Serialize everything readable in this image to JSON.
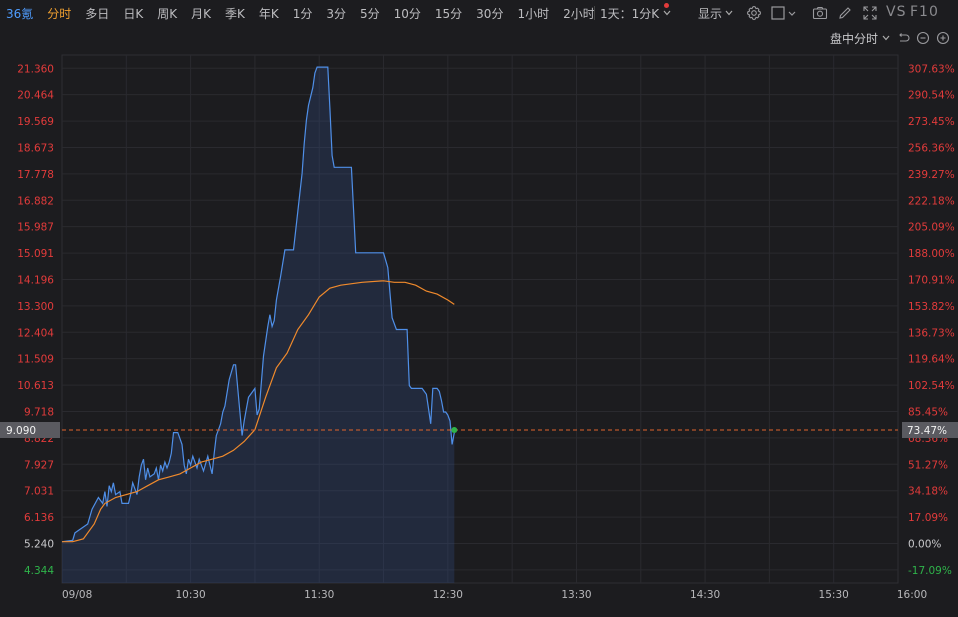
{
  "toolbar": {
    "stock_name": "36氪",
    "tabs": [
      "分时",
      "多日",
      "日K",
      "周K",
      "月K",
      "季K",
      "年K",
      "1分",
      "3分",
      "5分",
      "10分",
      "15分",
      "30分",
      "1小时",
      "2小时"
    ],
    "active_tab": "分时",
    "period_selector": "1天：1分K",
    "display_label": "显示",
    "vs_label": "VS",
    "f10_label": "F10"
  },
  "subbar": {
    "mode_label": "盘中分时"
  },
  "colors": {
    "price_line": "#4f8fe8",
    "avg_line": "#f08a2c",
    "up": "#e23b3b",
    "down": "#2fb34a",
    "ref_line": "#e0642c"
  },
  "current_price_tag": "9.090",
  "current_pct_tag": "73.47%",
  "chart_data": {
    "type": "line",
    "title": "",
    "xlabel": "",
    "ylabel": "",
    "ylim": [
      3.9,
      21.81
    ],
    "prev_close": 5.24,
    "left_axis_ticks": [
      "21.360",
      "20.464",
      "19.569",
      "18.673",
      "17.778",
      "16.882",
      "15.987",
      "15.091",
      "14.196",
      "13.300",
      "12.404",
      "11.509",
      "10.613",
      "9.718",
      "8.822",
      "7.927",
      "7.031",
      "6.136",
      "5.240",
      "4.344"
    ],
    "right_axis_ticks": [
      "307.63%",
      "290.54%",
      "273.45%",
      "256.36%",
      "239.27%",
      "222.18%",
      "205.09%",
      "188.00%",
      "170.91%",
      "153.82%",
      "136.73%",
      "119.64%",
      "102.54%",
      "85.45%",
      "68.36%",
      "51.27%",
      "34.18%",
      "17.09%",
      "0.00%",
      "-17.09%"
    ],
    "x_ticks": [
      "09/08",
      "10:30",
      "11:30",
      "12:30",
      "13:30",
      "14:30",
      "15:30",
      "16:00"
    ],
    "x_tick_minutes": [
      0,
      60,
      120,
      180,
      240,
      300,
      360,
      390
    ],
    "x_range": [
      0,
      390
    ],
    "series": [
      {
        "name": "",
        "kind": "price",
        "x": [
          0,
          5,
          6,
          12,
          14,
          17,
          19,
          20,
          21,
          22,
          23,
          24,
          25,
          27,
          28,
          31,
          32,
          33,
          35,
          36,
          37,
          38,
          39,
          40,
          41,
          43,
          44,
          45,
          46,
          47,
          48,
          49,
          50,
          51,
          52,
          54,
          56,
          57,
          58,
          59,
          60,
          61,
          63,
          64,
          66,
          68,
          70,
          71,
          72,
          73,
          74,
          75,
          76,
          78,
          80,
          81,
          83,
          84,
          85,
          86,
          87,
          89,
          90,
          91,
          92,
          94,
          96,
          97,
          98,
          99,
          100,
          102,
          104,
          105,
          106,
          107,
          108,
          110,
          112,
          113,
          114,
          115,
          117,
          118,
          119,
          120,
          121,
          122,
          123,
          124,
          125,
          126,
          127,
          128,
          129,
          130,
          131,
          132,
          133,
          134,
          135,
          136,
          137,
          138,
          139,
          140,
          141,
          142,
          143,
          144,
          146,
          148,
          150,
          152,
          154,
          156,
          158,
          160,
          161,
          162,
          163,
          164,
          165,
          166,
          167,
          168,
          169,
          170,
          171,
          172,
          173,
          174,
          175,
          176,
          177,
          178,
          179,
          180,
          181,
          182,
          183
        ],
        "values": [
          5.3,
          5.35,
          5.6,
          5.9,
          6.4,
          6.8,
          6.6,
          7.0,
          6.5,
          7.2,
          7.0,
          7.3,
          6.9,
          7.0,
          6.6,
          6.6,
          6.9,
          7.3,
          6.9,
          7.5,
          7.9,
          8.1,
          7.4,
          7.8,
          7.5,
          7.6,
          7.8,
          7.4,
          7.9,
          7.7,
          8.0,
          7.8,
          8.0,
          8.3,
          9.0,
          9.0,
          8.6,
          7.9,
          7.6,
          8.1,
          7.9,
          8.2,
          7.8,
          8.1,
          7.7,
          8.2,
          7.6,
          8.3,
          8.9,
          9.1,
          9.3,
          9.7,
          9.9,
          10.8,
          11.3,
          11.3,
          9.7,
          8.9,
          9.4,
          9.8,
          10.2,
          10.4,
          10.5,
          9.6,
          9.8,
          11.6,
          12.6,
          13.0,
          12.6,
          12.8,
          13.5,
          14.3,
          15.2,
          15.2,
          15.2,
          15.2,
          15.2,
          16.5,
          17.8,
          18.8,
          19.6,
          20.1,
          20.7,
          21.2,
          21.4,
          21.4,
          21.4,
          21.4,
          21.4,
          21.4,
          20.0,
          18.4,
          18.0,
          18.0,
          18.0,
          18.0,
          18.0,
          18.0,
          18.0,
          18.0,
          18.0,
          16.6,
          15.1,
          15.1,
          15.1,
          15.1,
          15.1,
          15.1,
          15.1,
          15.1,
          15.1,
          15.1,
          15.1,
          14.6,
          12.9,
          12.5,
          12.5,
          12.5,
          12.5,
          10.6,
          10.5,
          10.5,
          10.5,
          10.5,
          10.5,
          10.5,
          10.4,
          10.3,
          9.8,
          9.3,
          10.5,
          10.5,
          10.5,
          10.4,
          10.1,
          9.7,
          9.7,
          9.6,
          9.4,
          8.6,
          9.0
        ]
      },
      {
        "name": "",
        "kind": "average",
        "x": [
          0,
          5,
          10,
          15,
          18,
          20,
          25,
          30,
          35,
          40,
          45,
          50,
          55,
          60,
          65,
          70,
          75,
          80,
          85,
          90,
          95,
          100,
          105,
          110,
          115,
          120,
          125,
          130,
          140,
          150,
          155,
          160,
          165,
          170,
          175,
          180,
          183
        ],
        "values": [
          5.3,
          5.3,
          5.4,
          5.9,
          6.4,
          6.6,
          6.8,
          6.9,
          7.0,
          7.2,
          7.4,
          7.5,
          7.6,
          7.8,
          8.0,
          8.1,
          8.2,
          8.4,
          8.7,
          9.1,
          10.2,
          11.2,
          11.7,
          12.5,
          13.0,
          13.6,
          13.9,
          14.0,
          14.1,
          14.15,
          14.1,
          14.1,
          14.0,
          13.8,
          13.7,
          13.5,
          13.35
        ]
      }
    ],
    "current_price": 9.09,
    "current_pct": 73.47
  }
}
